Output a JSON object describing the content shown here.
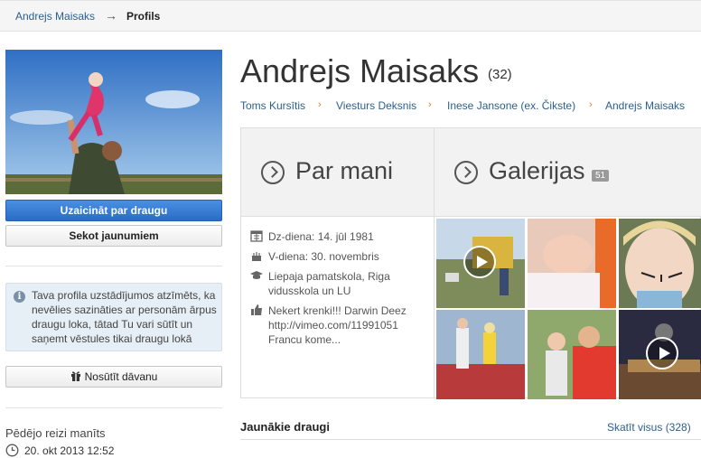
{
  "breadcrumb": {
    "parent": "Andrejs Maisaks",
    "arrow": "→",
    "current": "Profils"
  },
  "profile": {
    "name": "Andrejs Maisaks",
    "count": "(32)"
  },
  "lineage": [
    {
      "label": "Toms Kursītis"
    },
    {
      "label": "Viesturs Deksnis"
    },
    {
      "label": "Inese Jansone (ex. Čikste)"
    },
    {
      "label": "Andrejs Maisaks"
    }
  ],
  "lineage_sep": "›",
  "actions": {
    "invite_label": "Uzaicināt par draugu",
    "follow_label": "Sekot jaunumiem",
    "gift_label": "Nosūtīt dāvanu"
  },
  "notice": {
    "icon": "info-icon",
    "text": "Tava profila uzstādījumos atzīmēts, ka nevēlies sazināties ar personām ārpus draugu loka, tātad Tu vari sūtīt un saņemt vēstules tikai draugu lokā"
  },
  "last_seen": {
    "title": "Pēdējo reizi manīts",
    "time": "20. okt 2013 12:52"
  },
  "about": {
    "title": "Par mani",
    "birthday": "Dz-diena: 14. jūl 1981",
    "nameday": "V-diena: 30. novembris",
    "education": "Liepaja pamatskola, Riga vidusskola un LU",
    "like": "Nekert krenki!!! Darwin Deez http://vimeo.com/11991051 Francu kome..."
  },
  "gallery": {
    "title": "Galerijas",
    "badge": "51"
  },
  "friends": {
    "title": "Jaunākie draugi",
    "view_all": "Skatīt visus (328)"
  },
  "colors": {
    "link": "#2c5f8d",
    "primary_button": "#3a7fd5",
    "accent": "#e07a20"
  }
}
